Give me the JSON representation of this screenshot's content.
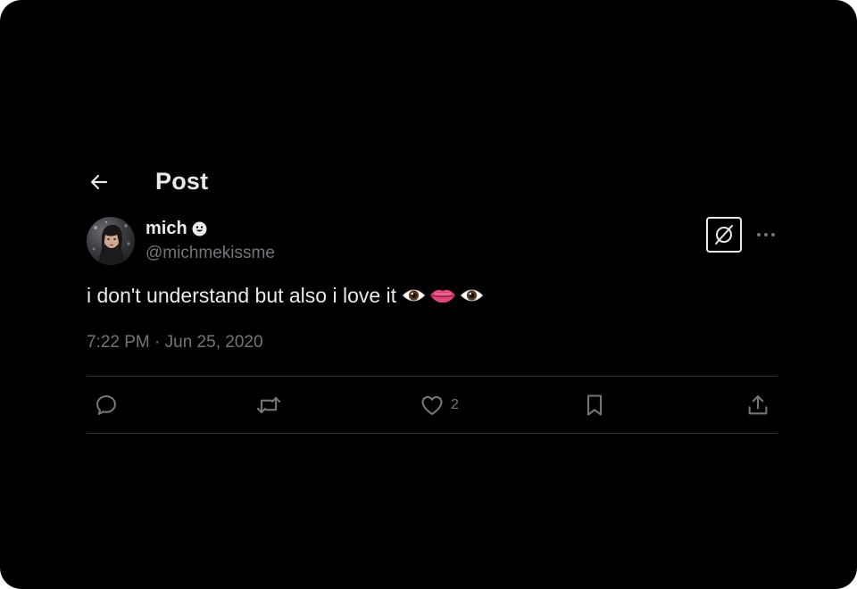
{
  "header": {
    "title": "Post",
    "back_icon": "arrow-left-icon"
  },
  "author": {
    "display_name": "mich",
    "name_badge_icon": "smiley-face-icon",
    "handle": "@michmekissme"
  },
  "top_actions": {
    "grok_icon": "grok-icon",
    "more_icon": "more-horizontal-icon"
  },
  "post": {
    "text": "i don't understand but also i love it",
    "emojis": [
      "eye",
      "lips",
      "eye"
    ],
    "timestamp": "7:22 PM · Jun 25, 2020"
  },
  "actions": {
    "reply": {
      "icon": "reply-icon",
      "count": ""
    },
    "repost": {
      "icon": "repost-icon",
      "count": ""
    },
    "like": {
      "icon": "heart-icon",
      "count": "2"
    },
    "bookmark": {
      "icon": "bookmark-icon",
      "count": ""
    },
    "share": {
      "icon": "share-icon",
      "count": ""
    }
  },
  "colors": {
    "background": "#000000",
    "primary_text": "#e7e9ea",
    "secondary_text": "#71767b",
    "divider": "#2f3336"
  }
}
